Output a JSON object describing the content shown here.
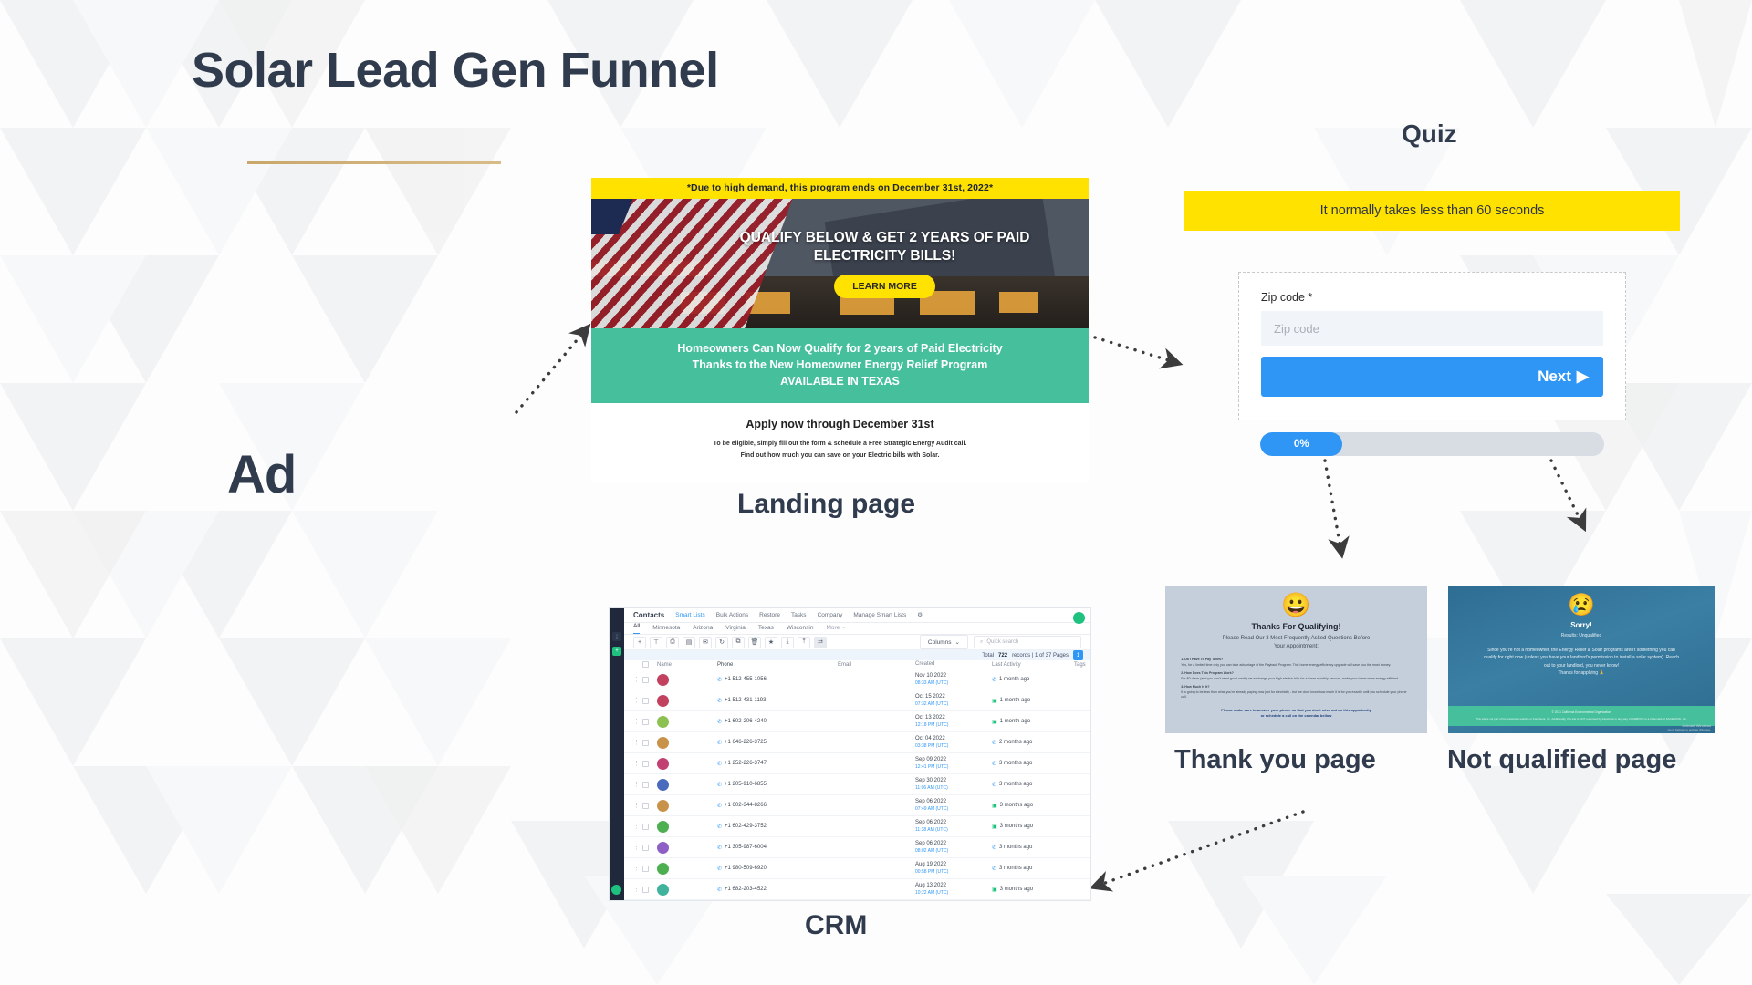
{
  "page": {
    "title": "Solar Lead Gen Funnel",
    "background_color": "#fdfdfd",
    "title_color": "#303b4d",
    "rule_color": "#c9a76a"
  },
  "labels": {
    "ad": "Ad",
    "landing_page": "Landing page",
    "quiz": "Quiz",
    "crm": "CRM",
    "thank_you_page": "Thank you page",
    "not_qualified_page": "Not qualified page"
  },
  "landing_page": {
    "top_banner": "*Due to high demand, this program ends on December 31st, 2022*",
    "headline": "QUALIFY BELOW & GET 2 YEARS OF PAID ELECTRICITY BILLS!",
    "cta_label": "LEARN MORE",
    "green_line1": "Homeowners Can Now Qualify for 2 years of Paid Electricity",
    "green_line2": "Thanks to the New Homeowner Energy Relief Program",
    "green_line3": "AVAILABLE IN TEXAS",
    "apply_heading": "Apply now through December 31st",
    "fine_line1": "To be eligible, simply fill out the form & schedule a Free Strategic Energy Audit call.",
    "fine_line2": "Find out how much you can save on your Electric bills with Solar.",
    "banner_color": "#ffe200",
    "green_color": "#45bf9c"
  },
  "quiz": {
    "banner_text": "It normally takes less than 60 seconds",
    "banner_color": "#ffe200",
    "field_label": "Zip code *",
    "field_placeholder": "Zip code",
    "field_value": "",
    "next_label": "Next",
    "next_arrow": "▶",
    "progress_percent": "0%",
    "progress_value": 0,
    "accent_color": "#2f96f6"
  },
  "thank_you_page": {
    "emoji": "😀",
    "heading": "Thanks For Qualifying!",
    "sub_line1": "Please Read Our 3 Most Frequently Asked Questions Before",
    "sub_line2": "Your Appointment:",
    "faqs": [
      {
        "q": "1. Do I Have To Pay Taxes?",
        "a": "Yes, for a limited time only you can take advantage of the Payback Program. This home energy efficiency upgrade will save you the most money."
      },
      {
        "q": "2. How Does This Program Work?",
        "a": "For $0 down (and you don't need good credit) we exchange your high electric bills for a lower monthly amount, make your home more energy efficient."
      },
      {
        "q": "3. How Much Is It?",
        "a": "It is going to be less than what you're already paying now just for electricity - but we don't know how much it is for you exactly until you schedule your phone call."
      }
    ],
    "footer_line1": "Please make sure to answer your phone so that you don't miss out on this opportunity",
    "footer_line2": "or schedule a call on the calendar bellow",
    "background_color": "#c5cfdb"
  },
  "not_qualified_page": {
    "emoji": "😢",
    "heading": "Sorry!",
    "subheading": "Results: Unqualified",
    "body_line1": "Since you're not a homeowner, the Energy Relief & Solar programs aren't something you can",
    "body_line2": "qualify for right now (unless you have your landlord's permission to install a solar system). Reach",
    "body_line3": "out to your landlord, you never know!",
    "body_line4": "Thanks for applying 🙏",
    "footer_line1": "© 2021 California Environmental Organization",
    "footer_line2": "This site is not part of the Facebook website or Facebook, Inc. Additionally, this site is NOT endorsed by Facebook in any way. FACEBOOK is a trademark of FACEBOOK, Inc.",
    "watermark_line1": "Activate Windows",
    "watermark_line2": "Go to Settings to activate Windows.",
    "background_color": "#3b7fa4",
    "footer_color": "#45bf9c"
  },
  "crm": {
    "app_title": "Contacts",
    "tabs": [
      {
        "label": "Smart Lists",
        "active": true
      },
      {
        "label": "Bulk Actions",
        "active": false
      },
      {
        "label": "Restore",
        "active": false
      },
      {
        "label": "Tasks",
        "active": false
      },
      {
        "label": "Company",
        "active": false
      },
      {
        "label": "Manage Smart Lists",
        "active": false
      }
    ],
    "settings_icon": "gear-icon",
    "filters": [
      {
        "label": "All",
        "active": true
      },
      {
        "label": "Minnesota",
        "active": false
      },
      {
        "label": "Arizona",
        "active": false
      },
      {
        "label": "Virginia",
        "active": false
      },
      {
        "label": "Texas",
        "active": false
      },
      {
        "label": "Wisconsin",
        "active": false
      },
      {
        "label": "More ~",
        "active": false
      }
    ],
    "toolbar_icons": [
      "plus-icon",
      "filter-icon",
      "print-icon",
      "message-icon",
      "email-icon",
      "restore-icon",
      "copy-icon",
      "trash-icon",
      "star-icon",
      "import-icon",
      "export-icon",
      "merge-icon"
    ],
    "columns_label": "Columns",
    "search_placeholder": "Quick search",
    "records_text_prefix": "Total",
    "records_count": "722",
    "records_text_suffix": "records | 1 of 37 Pages",
    "page_badge": "1",
    "table_headers": [
      "Name",
      "Phone",
      "Email",
      "Created",
      "Last Activity",
      "Tags"
    ],
    "rows": [
      {
        "avatar_color": "#c2415e",
        "phone": "+1 512-455-1056",
        "created_date": "Nov 10 2022",
        "created_time": "08:33 AM (UTC)",
        "last_activity": "1 month ago",
        "activity_icon": "phone-icon",
        "activity_color": "#2f96f6"
      },
      {
        "avatar_color": "#c2415e",
        "phone": "+1 512-431-1193",
        "created_date": "Oct 15 2022",
        "created_time": "07:32 AM (UTC)",
        "last_activity": "1 month ago",
        "activity_icon": "message-icon",
        "activity_color": "#1ec27e"
      },
      {
        "avatar_color": "#8cc152",
        "phone": "+1 602-206-4240",
        "created_date": "Oct 13 2022",
        "created_time": "12:18 PM (UTC)",
        "last_activity": "1 month ago",
        "activity_icon": "message-icon",
        "activity_color": "#1ec27e"
      },
      {
        "avatar_color": "#c8924a",
        "phone": "+1 646-226-3725",
        "created_date": "Oct 04 2022",
        "created_time": "03:38 PM (UTC)",
        "last_activity": "2 months ago",
        "activity_icon": "phone-icon",
        "activity_color": "#2f96f6"
      },
      {
        "avatar_color": "#c24173",
        "phone": "+1 252-226-3747",
        "created_date": "Sep 09 2022",
        "created_time": "12:41 PM (UTC)",
        "last_activity": "3 months ago",
        "activity_icon": "phone-icon",
        "activity_color": "#2f96f6"
      },
      {
        "avatar_color": "#4a6bbd",
        "phone": "+1 205-910-6855",
        "created_date": "Sep 30 2022",
        "created_time": "11:06 AM (UTC)",
        "last_activity": "3 months ago",
        "activity_icon": "phone-icon",
        "activity_color": "#2f96f6"
      },
      {
        "avatar_color": "#c8924a",
        "phone": "+1 602-344-8266",
        "created_date": "Sep 06 2022",
        "created_time": "07:49 AM (UTC)",
        "last_activity": "3 months ago",
        "activity_icon": "message-icon",
        "activity_color": "#1ec27e"
      },
      {
        "avatar_color": "#4caf50",
        "phone": "+1 602-429-3752",
        "created_date": "Sep 06 2022",
        "created_time": "11:38 AM (UTC)",
        "last_activity": "3 months ago",
        "activity_icon": "message-icon",
        "activity_color": "#1ec27e"
      },
      {
        "avatar_color": "#8e5fc4",
        "phone": "+1 305-987-6004",
        "created_date": "Sep 06 2022",
        "created_time": "08:02 AM (UTC)",
        "last_activity": "3 months ago",
        "activity_icon": "phone-icon",
        "activity_color": "#2f96f6"
      },
      {
        "avatar_color": "#4caf50",
        "phone": "+1 980-509-6920",
        "created_date": "Aug 19 2022",
        "created_time": "00:58 PM (UTC)",
        "last_activity": "3 months ago",
        "activity_icon": "phone-icon",
        "activity_color": "#2f96f6"
      },
      {
        "avatar_color": "#3fb39b",
        "phone": "+1 682-203-4522",
        "created_date": "Aug 13 2022",
        "created_time": "10:22 AM (UTC)",
        "last_activity": "3 months ago",
        "activity_icon": "message-icon",
        "activity_color": "#1ec27e"
      }
    ]
  }
}
